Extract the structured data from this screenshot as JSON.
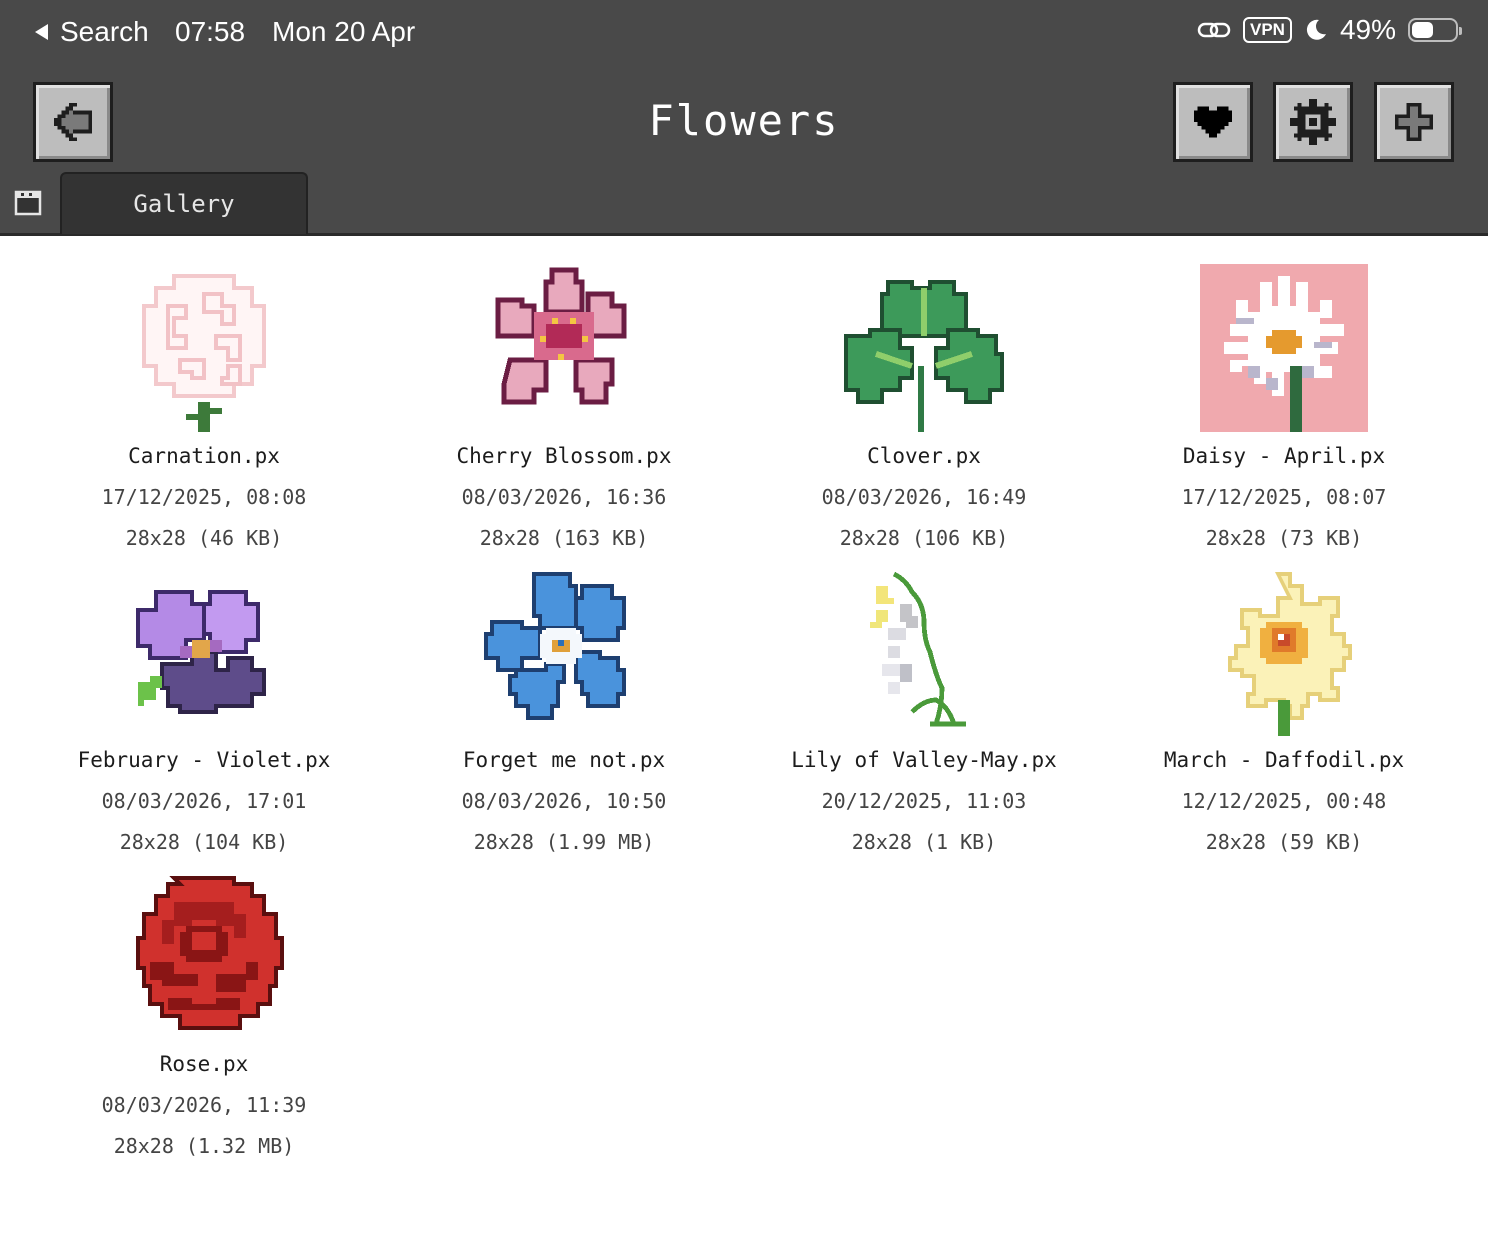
{
  "status_bar": {
    "back_label": "Search",
    "time": "07:58",
    "date": "Mon 20 Apr",
    "vpn": "VPN",
    "battery": "49%",
    "battery_level": 0.49
  },
  "header": {
    "title": "Flowers",
    "buttons": {
      "back": "back-arrow-icon",
      "favorite": "heart-icon",
      "settings": "gear-icon",
      "add": "plus-icon"
    }
  },
  "tabs": [
    {
      "label": "Gallery"
    }
  ],
  "gallery": [
    {
      "name": "Carnation.px",
      "modified": "17/12/2025, 08:08",
      "size": "28x28 (46 KB)"
    },
    {
      "name": "Cherry Blossom.px",
      "modified": "08/03/2026, 16:36",
      "size": "28x28 (163 KB)"
    },
    {
      "name": "Clover.px",
      "modified": "08/03/2026, 16:49",
      "size": "28x28 (106 KB)"
    },
    {
      "name": "Daisy - April.px",
      "modified": "17/12/2025, 08:07",
      "size": "28x28 (73 KB)"
    },
    {
      "name": "February - Violet.px",
      "modified": "08/03/2026, 17:01",
      "size": "28x28 (104 KB)"
    },
    {
      "name": "Forget me not.px",
      "modified": "08/03/2026, 10:50",
      "size": "28x28 (1.99 MB)"
    },
    {
      "name": "Lily of Valley-May.px",
      "modified": "20/12/2025, 11:03",
      "size": "28x28 (1 KB)"
    },
    {
      "name": "March - Daffodil.px",
      "modified": "12/12/2025, 00:48",
      "size": "28x28 (59 KB)"
    },
    {
      "name": "Rose.px",
      "modified": "08/03/2026, 11:39",
      "size": "28x28 (1.32 MB)"
    }
  ]
}
